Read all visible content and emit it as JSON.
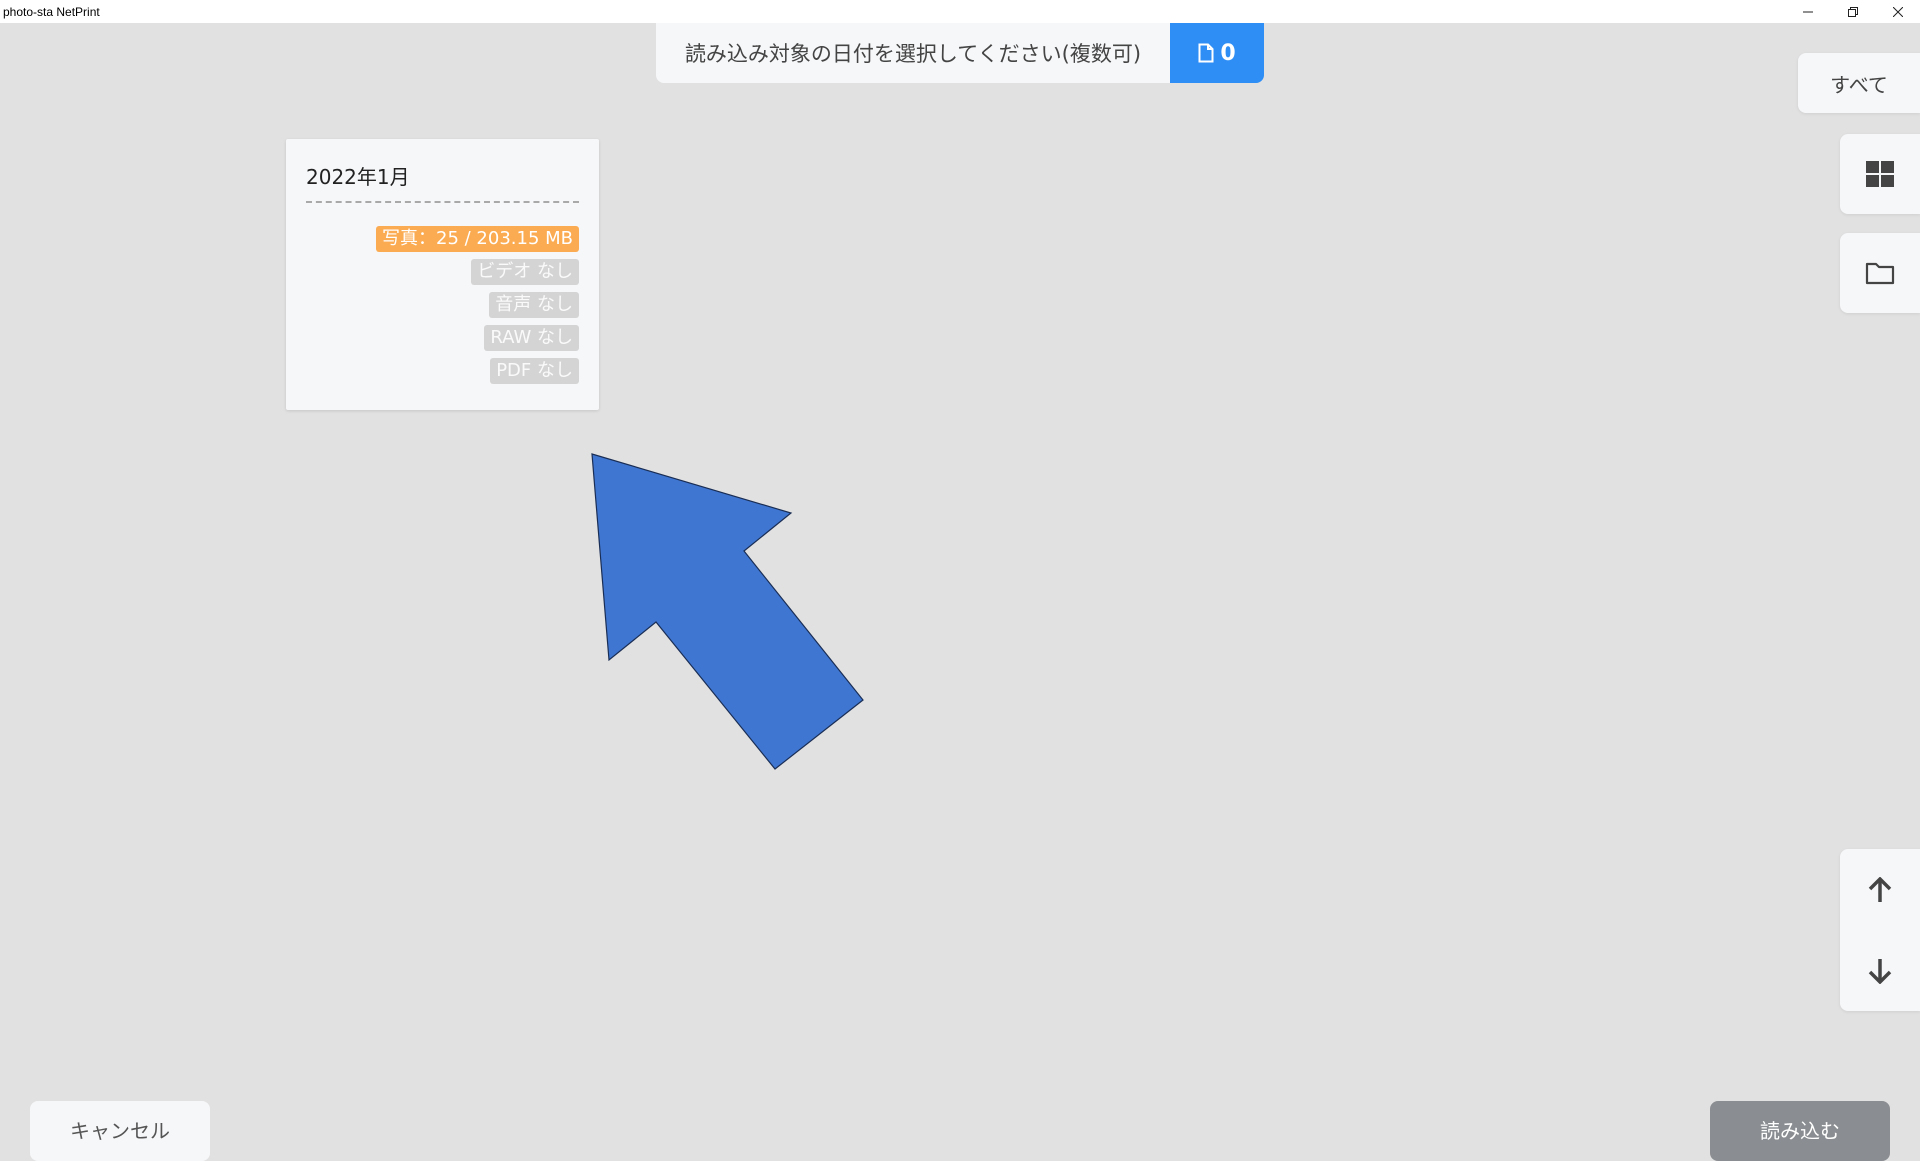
{
  "window": {
    "title": "photo-sta NetPrint",
    "minimize_icon": "minimize-icon",
    "restore_icon": "restore-icon",
    "close_icon": "close-icon"
  },
  "header": {
    "instruction": "読み込み対象の日付を選択してください(複数可)",
    "selected_count": "0",
    "count_icon": "file-icon",
    "count_color": "#2e8ef5"
  },
  "sidebar": {
    "all_label": "すべて",
    "grid_icon": "grid-view-icon",
    "folder_icon": "folder-icon",
    "scroll_up_icon": "arrow-up-icon",
    "scroll_down_icon": "arrow-down-icon"
  },
  "date_cards": [
    {
      "title": "2022年1月",
      "photo": "写真：25 / 203.15 MB",
      "video": "ビデオ なし",
      "audio": "音声 なし",
      "raw": "RAW なし",
      "pdf": "PDF なし",
      "photo_color": "#fbab52",
      "none_color": "#d4d4d4"
    }
  ],
  "overlay": {
    "arrow_color": "#3f76d1"
  },
  "footer": {
    "cancel_label": "キャンセル",
    "import_label": "読み込む"
  }
}
